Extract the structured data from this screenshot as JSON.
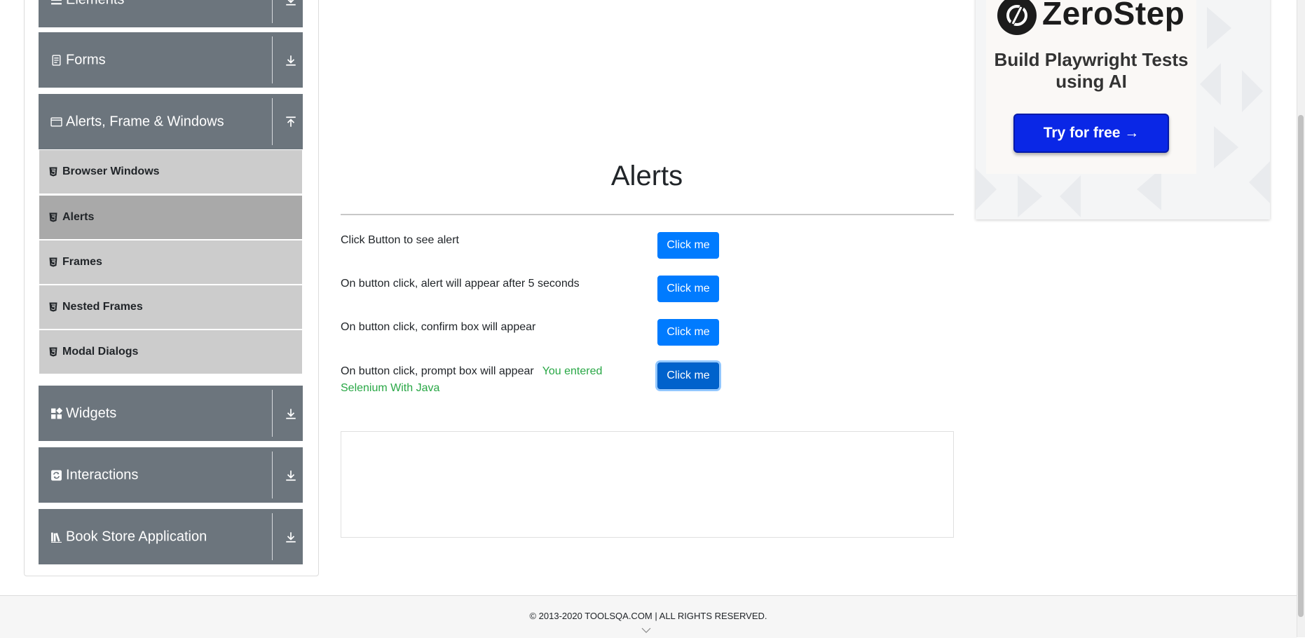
{
  "sidebar": {
    "groups": [
      {
        "label": "Elements",
        "icon": "list-icon",
        "arrow": "expand-arrow-icon"
      },
      {
        "label": "Forms",
        "icon": "form-document-icon",
        "arrow": "expand-arrow-icon"
      },
      {
        "label": "Alerts, Frame & Windows",
        "icon": "window-icon",
        "arrow": "collapse-arrow-icon"
      },
      {
        "label": "Widgets",
        "icon": "widgets-grid-icon",
        "arrow": "expand-arrow-icon"
      },
      {
        "label": "Interactions",
        "icon": "interactions-icon",
        "arrow": "expand-arrow-icon"
      },
      {
        "label": "Book Store Application",
        "icon": "books-icon",
        "arrow": "expand-arrow-icon"
      }
    ],
    "subitems": [
      {
        "label": "Browser Windows",
        "active": false
      },
      {
        "label": "Alerts",
        "active": true
      },
      {
        "label": "Frames",
        "active": false
      },
      {
        "label": "Nested Frames",
        "active": false
      },
      {
        "label": "Modal Dialogs",
        "active": false
      }
    ]
  },
  "main": {
    "title": "Alerts",
    "rows": [
      {
        "label": "Click Button to see alert",
        "button": "Click me"
      },
      {
        "label": "On button click, alert will appear after 5 seconds",
        "button": "Click me"
      },
      {
        "label": "On button click, confirm box will appear",
        "button": "Click me"
      },
      {
        "label": "On button click, prompt box will appear",
        "result": "You entered Selenium With Java",
        "button": "Click me"
      }
    ]
  },
  "ad": {
    "brand": "ZeroStep",
    "headline": "Build Playwright Tests using AI",
    "cta": "Try for free →"
  },
  "footer": {
    "copyright": "© 2013-2020 TOOLSQA.COM | ALL RIGHTS RESERVED."
  },
  "colors": {
    "sidebar_header_bg": "#6c757d",
    "sidebar_item_bg": "#cccccc",
    "sidebar_item_active_bg": "#a9a9a9",
    "primary_button": "#007bff",
    "result_text": "#28a745",
    "ad_cta": "#0a27e6"
  }
}
